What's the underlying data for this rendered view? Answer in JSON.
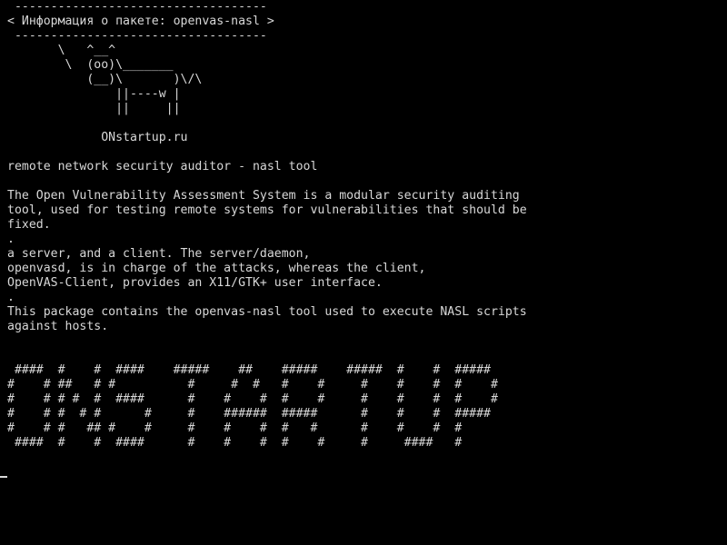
{
  "terminal": {
    "bubble": [
      " -----------------------------------",
      "< Информация о пакете: openvas-nasl >",
      " -----------------------------------"
    ],
    "cow": [
      "       \\   ^__^",
      "        \\  (oo)\\_______",
      "           (__)\\       )\\/\\",
      "               ||----w |",
      "               ||     ||"
    ],
    "site": "             ONstartup.ru",
    "summary": "remote network security auditor - nasl tool",
    "description": [
      "The Open Vulnerability Assessment System is a modular security auditing",
      "tool, used for testing remote systems for vulnerabilities that should be",
      "fixed.",
      ".",
      "a server, and a client. The server/daemon,",
      "openvasd, is in charge of the attacks, whereas the client,",
      "OpenVAS-Client, provides an X11/GTK+ user interface.",
      ".",
      "This package contains the openvas-nasl tool used to execute NASL scripts",
      "against hosts."
    ],
    "banner": [
      " ####  #    #  ####    #####    ##    #####    #####  #    #  #####",
      "#    # ##   # #          #     #  #   #    #     #    #    #  #    #",
      "#    # # #  #  ####      #    #    #  #    #     #    #    #  #    #",
      "#    # #  # #      #     #    ######  #####      #    #    #  #####",
      "#    # #   ## #    #     #    #    #  #   #      #    #    #  #",
      " ####  #    #  ####      #    #    #  #    #     #     ####   #"
    ],
    "colors": {
      "background": "#000000",
      "foreground": "#d8d8d8"
    }
  }
}
